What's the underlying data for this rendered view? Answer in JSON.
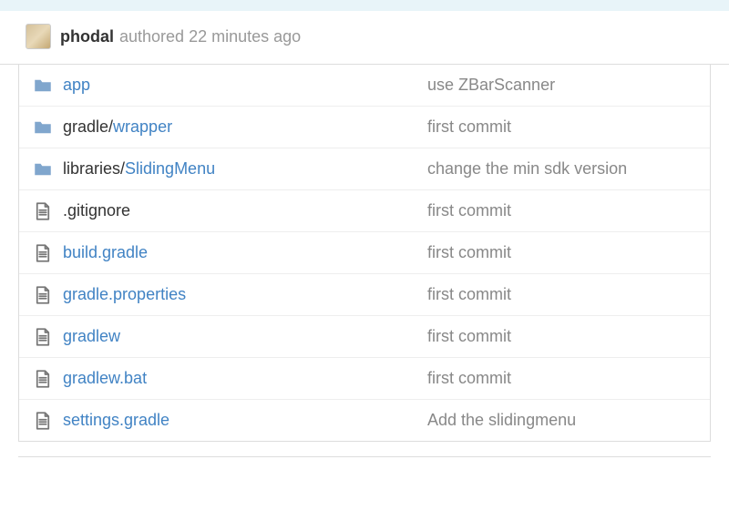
{
  "header": {
    "author": "phodal",
    "authored_label": "authored",
    "time_ago": "22 minutes ago"
  },
  "files": [
    {
      "type": "folder",
      "prefix": "",
      "name": "app",
      "msg": "use ZBarScanner"
    },
    {
      "type": "folder",
      "prefix": "gradle/",
      "name": "wrapper",
      "msg": "first commit"
    },
    {
      "type": "folder",
      "prefix": "libraries/",
      "name": "SlidingMenu",
      "msg": "change the min sdk version"
    },
    {
      "type": "file",
      "prefix": "",
      "name": ".gitignore",
      "muted": true,
      "msg": "first commit"
    },
    {
      "type": "file",
      "prefix": "",
      "name": "build.gradle",
      "msg": "first commit"
    },
    {
      "type": "file",
      "prefix": "",
      "name": "gradle.properties",
      "msg": "first commit"
    },
    {
      "type": "file",
      "prefix": "",
      "name": "gradlew",
      "msg": "first commit"
    },
    {
      "type": "file",
      "prefix": "",
      "name": "gradlew.bat",
      "msg": "first commit"
    },
    {
      "type": "file",
      "prefix": "",
      "name": "settings.gradle",
      "msg": "Add the slidingmenu"
    }
  ]
}
